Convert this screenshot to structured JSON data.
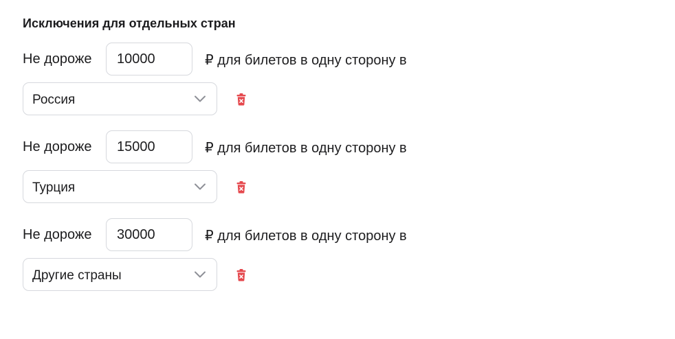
{
  "section": {
    "title": "Исключения для отдельных стран"
  },
  "rules": [
    {
      "prefix": "Не дороже",
      "price": "10000",
      "suffix": "₽ для билетов в одну сторону в",
      "country": "Россия"
    },
    {
      "prefix": "Не дороже",
      "price": "15000",
      "suffix": "₽ для билетов в одну сторону в",
      "country": "Турция"
    },
    {
      "prefix": "Не дороже",
      "price": "30000",
      "suffix": "₽ для билетов в одну сторону в",
      "country": "Другие страны"
    }
  ],
  "icons": {
    "select_chevron": "chevron-down-icon",
    "delete": "trash-icon"
  },
  "colors": {
    "text": "#1c1c1e",
    "border": "#d6d8dd",
    "chevron": "#8e9097",
    "delete": "#e5484d"
  }
}
